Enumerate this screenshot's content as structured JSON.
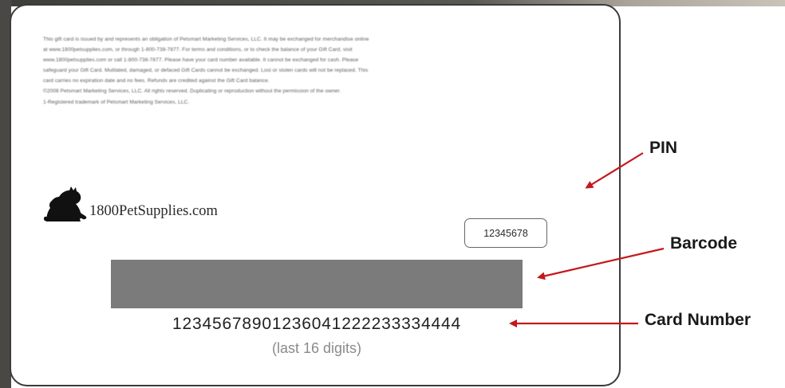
{
  "card": {
    "fine_print_lines": [
      "This gift card is issued by and represents an obligation of Petsmart Marketing Services, LLC. It may be exchanged for merchandise online",
      "at www.1800petsupplies.com, or through 1-800-738-7877. For terms and conditions, or to check the balance of your Gift Card, visit",
      "www.1800petsupplies.com or call 1-800-738-7877. Please have your card number available. It cannot be exchanged for cash. Please",
      "safeguard your Gift Card. Mutilated, damaged, or defaced Gift Cards cannot be exchanged. Lost or stolen cards will not be replaced. This",
      "card carries no expiration date and no fees. Refunds are credited against the Gift Card balance.",
      "©2008 Petsmart Marketing Services, LLC. All rights reserved. Duplicating or reproduction without the permission of the owner.",
      "1-Registered trademark of Petsmart Marketing Services, LLC."
    ],
    "logo_text": "1800PetSupplies.com",
    "pin_value": "12345678",
    "card_number": "12345678901236041222233334444",
    "card_number_hint": "(last 16 digits)"
  },
  "callouts": {
    "pin": "PIN",
    "barcode": "Barcode",
    "card_number": "Card Number"
  },
  "colors": {
    "arrow": "#c4181e",
    "barcode_fill": "#7b7b7b",
    "card_border": "#3b3b3b"
  },
  "icons": {
    "logo": "black-cat-silhouette-icon"
  }
}
